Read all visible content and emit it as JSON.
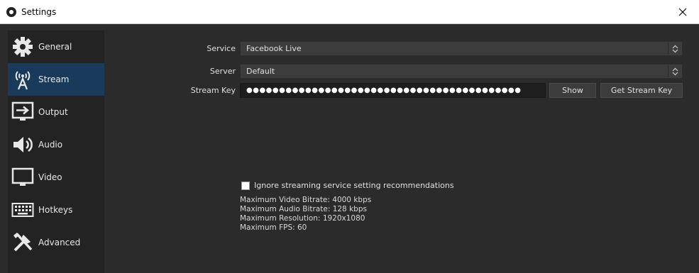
{
  "window": {
    "title": "Settings",
    "close_icon": "close-icon"
  },
  "sidebar": {
    "items": [
      {
        "label": "General",
        "icon": "gear-icon",
        "active": false
      },
      {
        "label": "Stream",
        "icon": "broadcast-antenna-icon",
        "active": true
      },
      {
        "label": "Output",
        "icon": "output-monitor-icon",
        "active": false
      },
      {
        "label": "Audio",
        "icon": "speaker-icon",
        "active": false
      },
      {
        "label": "Video",
        "icon": "monitor-icon",
        "active": false
      },
      {
        "label": "Hotkeys",
        "icon": "keyboard-icon",
        "active": false
      },
      {
        "label": "Advanced",
        "icon": "tools-icon",
        "active": false
      }
    ]
  },
  "stream": {
    "service_label": "Service",
    "service_value": "Facebook Live",
    "server_label": "Server",
    "server_value": "Default",
    "stream_key_label": "Stream Key",
    "stream_key_value": "●●●●●●●●●●●●●●●●●●●●●●●●●●●●●●●●●●●●●●●●●●",
    "show_button": "Show",
    "get_key_button": "Get Stream Key",
    "ignore_recommendations_label": "Ignore streaming service setting recommendations",
    "ignore_recommendations_checked": false,
    "max_video_bitrate": "Maximum Video Bitrate: 4000 kbps",
    "max_audio_bitrate": "Maximum Audio Bitrate: 128 kbps",
    "max_resolution": "Maximum Resolution: 1920x1080",
    "max_fps": "Maximum FPS: 60"
  },
  "colors": {
    "background": "#2b2b2b",
    "sidebar": "#232323",
    "active_item": "#193a5a",
    "input": "#3c3c3c"
  }
}
